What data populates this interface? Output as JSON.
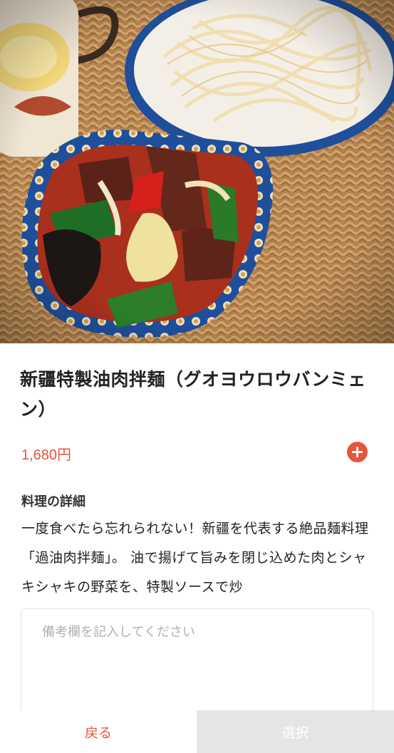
{
  "dish": {
    "image_alt": "油肉拌麺",
    "title": "新疆特製油肉拌麺（グオヨウロウバンミェン）",
    "price": "1,680円",
    "add_icon": "plus-circle-icon"
  },
  "details": {
    "heading": "料理の詳細",
    "text": "一度食べたら忘れられない！新疆を代表する絶品麺料理「過油肉拌麺」。 油で揚げて旨みを閉じ込めた肉とシャキシャキの野菜を、特製ソースで炒"
  },
  "remarks": {
    "placeholder": "備考欄を記入してください"
  },
  "footer": {
    "back_label": "戻る",
    "select_label": "選択"
  },
  "colors": {
    "accent": "#e8553a",
    "disabled": "#e5e5e5"
  }
}
